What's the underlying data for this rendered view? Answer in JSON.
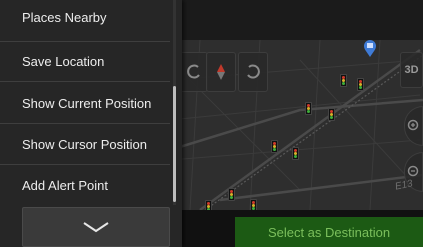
{
  "menu": {
    "items": [
      {
        "label": "Places Nearby"
      },
      {
        "label": "Save Location"
      },
      {
        "label": "Show Current Position"
      },
      {
        "label": "Show Cursor Position"
      },
      {
        "label": "Add Alert Point"
      }
    ],
    "more_icon": "chevron-down-icon"
  },
  "map": {
    "select_destination_label": "Select as Destination",
    "street_label": "E13",
    "view_mode_label": "3D",
    "icons": [
      "undo-icon",
      "compass-icon",
      "redo-icon",
      "zoom-in-icon",
      "zoom-out-icon",
      "traffic-light-icon",
      "destination-pin-icon"
    ]
  },
  "colors": {
    "menu_background": "#262626",
    "menu_text": "#ededed",
    "map_background": "#2b2b2b",
    "select_button": "#1c5a14",
    "pin": "#3f7bd6"
  }
}
